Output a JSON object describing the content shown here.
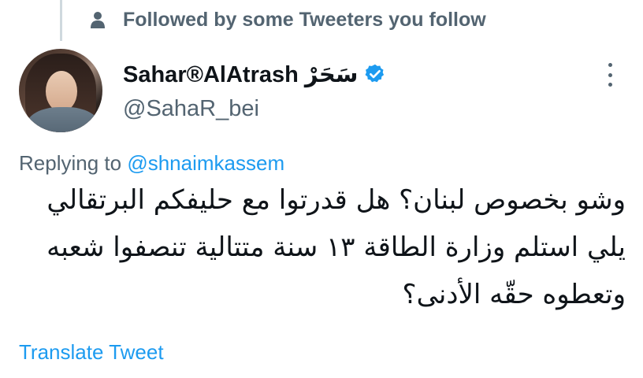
{
  "social_context": {
    "text": "Followed by some Tweeters you follow",
    "icon": "person-icon"
  },
  "author": {
    "display_name": "Sahar®AlAtrash سَحَرْ",
    "handle": "@SahaR_bei",
    "verified": true,
    "verified_color": "#1d9bf0"
  },
  "reply": {
    "prefix": "Replying to ",
    "mention": "@shnaimkassem"
  },
  "tweet": {
    "text": "وشو بخصوص لبنان؟ هل قدرتوا مع حليفكم البرتقالي يلي استلم وزارة الطاقة ١٣ سنة متتالية تنصفوا شعبه وتعطوه حقّه الأدنى؟"
  },
  "actions": {
    "translate_label": "Translate Tweet",
    "more_icon": "more-vertical-icon"
  },
  "colors": {
    "link": "#1d9bf0",
    "secondary_text": "#536471",
    "primary_text": "#0f1419",
    "thread_line": "#cfd9de"
  }
}
